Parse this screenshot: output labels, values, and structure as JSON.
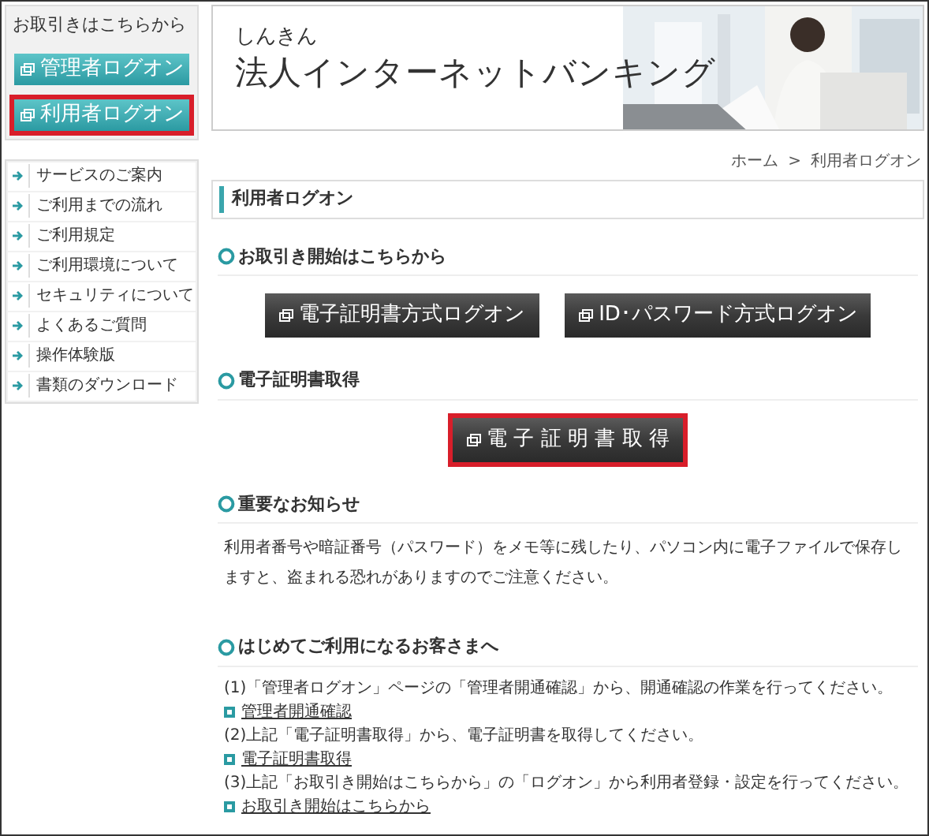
{
  "sidebar": {
    "heading": "お取引きはこちらから",
    "login_buttons": [
      {
        "label": "管理者ログオン",
        "highlighted": false
      },
      {
        "label": "利用者ログオン",
        "highlighted": true
      }
    ],
    "nav_items": [
      "サービスのご案内",
      "ご利用までの流れ",
      "ご利用規定",
      "ご利用環境について",
      "セキュリティについて",
      "よくあるご質問",
      "操作体験版",
      "書類のダウンロード"
    ]
  },
  "header": {
    "subtitle": "しんきん",
    "title": "法人インターネットバンキング"
  },
  "breadcrumb": {
    "items": [
      "ホーム",
      "利用者ログオン"
    ],
    "separator": ">"
  },
  "page_title": "利用者ログオン",
  "sections": [
    {
      "kind": "buttons",
      "heading": "お取引き開始はこちらから",
      "buttons": [
        {
          "label": "電子証明書方式ログオン",
          "highlighted": false
        },
        {
          "label": "ID･パスワード方式ログオン",
          "highlighted": false
        }
      ]
    },
    {
      "kind": "buttons",
      "heading": "電子証明書取得",
      "buttons": [
        {
          "label": "電 子 証 明 書 取 得",
          "highlighted": true
        }
      ]
    },
    {
      "kind": "notice",
      "heading": "重要なお知らせ",
      "text": "利用者番号や暗証番号（パスワード）をメモ等に残したり、パソコン内に電子ファイルで保存しますと、盗まれる恐れがありますのでご注意ください。"
    },
    {
      "kind": "steps",
      "heading": "はじめてご利用になるお客さまへ",
      "steps": [
        {
          "text": "(1)「管理者ログオン」ページの「管理者開通確認」から、開通確認の作業を行ってください。",
          "link": "管理者開通確認"
        },
        {
          "text": "(2)上記「電子証明書取得」から、電子証明書を取得してください。",
          "link": "電子証明書取得"
        },
        {
          "text": "(3)上記「お取引き開始はこちらから」の「ログオン」から利用者登録・設定を行ってください。",
          "link": "お取引き開始はこちらから"
        }
      ]
    }
  ]
}
